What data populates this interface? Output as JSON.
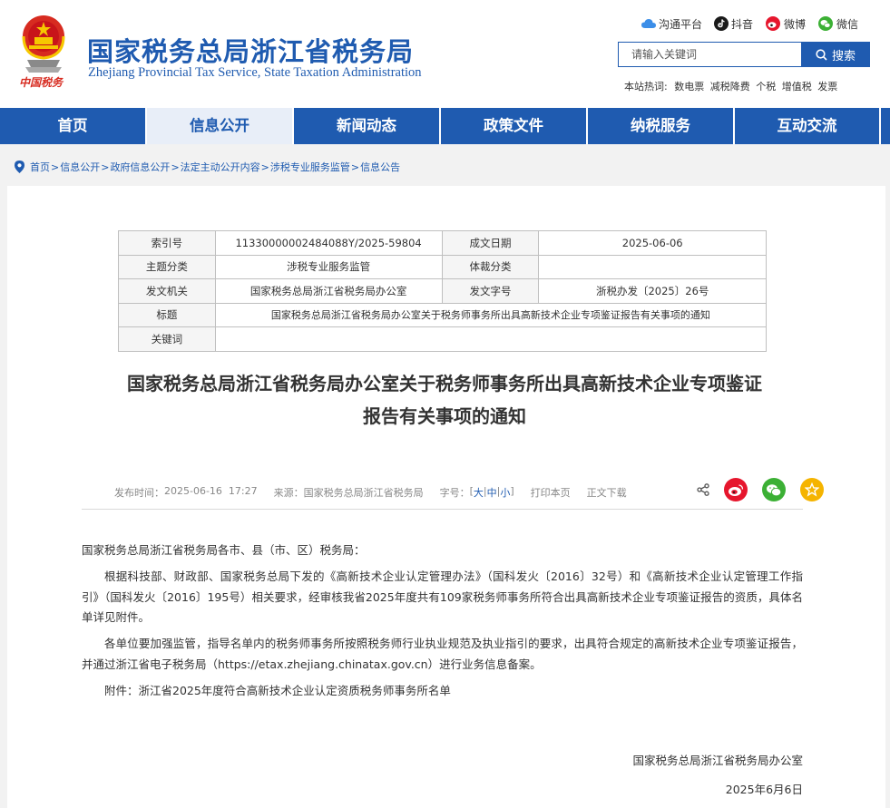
{
  "header": {
    "title": "国家税务总局浙江省税务局",
    "subtitle": "Zhejiang Provincial Tax Service, State Taxation Administration",
    "emblem_caption": "中国税务",
    "social": [
      {
        "label": "沟通平台",
        "icon": "cloud-icon"
      },
      {
        "label": "抖音",
        "icon": "douyin-icon"
      },
      {
        "label": "微博",
        "icon": "weibo-icon"
      },
      {
        "label": "微信",
        "icon": "wechat-icon"
      }
    ],
    "search_placeholder": "请输入关键词",
    "search_button": "搜索",
    "hot_label": "本站热词:",
    "hot_words": [
      "数电票",
      "减税降费",
      "个税",
      "增值税",
      "发票"
    ]
  },
  "nav": {
    "items": [
      "首页",
      "信息公开",
      "新闻动态",
      "政策文件",
      "纳税服务",
      "互动交流"
    ],
    "active": "信息公开"
  },
  "breadcrumb": [
    "首页",
    "信息公开",
    "政府信息公开",
    "法定主动公开内容",
    "涉税专业服务监管",
    "信息公告"
  ],
  "meta": {
    "rows": [
      [
        "索引号",
        "11330000002484088Y/2025-59804",
        "成文日期",
        "2025-06-06"
      ],
      [
        "主题分类",
        "涉税专业服务监管",
        "体裁分类",
        ""
      ],
      [
        "发文机关",
        "国家税务总局浙江省税务局办公室",
        "发文字号",
        "浙税办发〔2025〕26号"
      ]
    ],
    "title_label": "标题",
    "title_value": "国家税务总局浙江省税务局办公室关于税务师事务所出具高新技术企业专项鉴证报告有关事项的通知",
    "keyword_label": "关键词",
    "keyword_value": ""
  },
  "article": {
    "title_line1": "国家税务总局浙江省税务局办公室关于税务师事务所出具高新技术企业专项鉴证",
    "title_line2": "报告有关事项的通知",
    "publish_label": "发布时间：",
    "publish_time": "2025-06-16  17:27",
    "source_label": "来源：",
    "source": "国家税务总局浙江省税务局",
    "fontsize_label": "字号：",
    "fs_large": "大",
    "fs_medium": "中",
    "fs_small": "小",
    "print": "打印本页",
    "download": "正文下载",
    "salutation": "国家税务总局浙江省税务局各市、县（市、区）税务局：",
    "para1": "根据科技部、财政部、国家税务总局下发的《高新技术企业认定管理办法》（国科发火〔2016〕32号）和《高新技术企业认定管理工作指引》（国科发火〔2016〕195号）相关要求，经审核我省2025年度共有109家税务师事务所符合出具高新技术企业专项鉴证报告的资质，具体名单详见附件。",
    "para2": "各单位要加强监管，指导名单内的税务师事务所按照税务师行业执业规范及执业指引的要求，出具符合规定的高新技术企业专项鉴证报告，并通过浙江省电子税务局（https://etax.zhejiang.chinatax.gov.cn）进行业务信息备案。",
    "attachment": "附件：浙江省2025年度符合高新技术企业认定资质税务师事务所名单",
    "sign_org": "国家税务总局浙江省税务局办公室",
    "sign_date": "2025年6月6日"
  },
  "colors": {
    "brand_blue": "#1f5bb0",
    "weibo_red": "#e6162d",
    "wechat_green": "#3cb035",
    "favorite_yellow": "#f5b400"
  }
}
